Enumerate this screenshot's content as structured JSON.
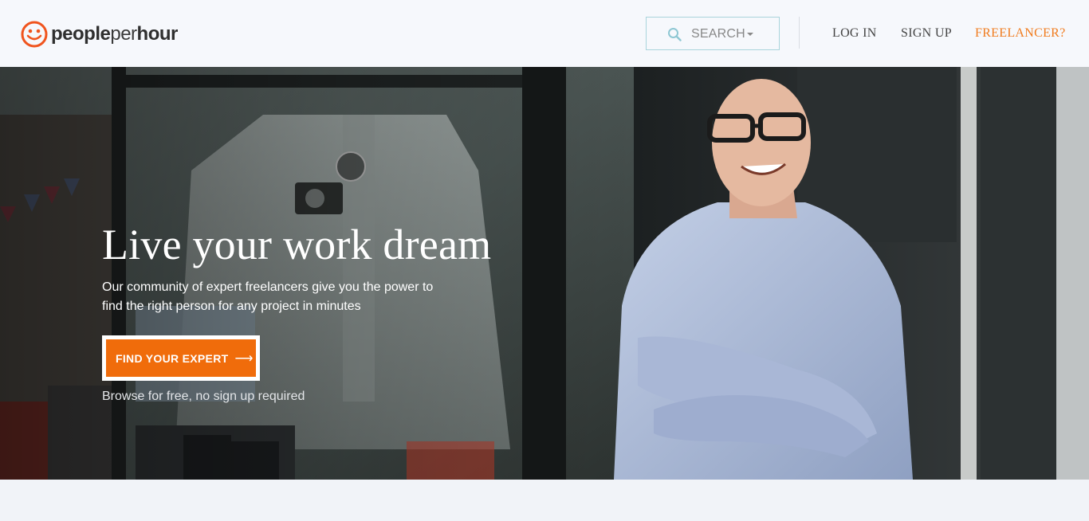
{
  "brand": {
    "name_part1": "people",
    "name_part2": "per",
    "name_part3": "hour",
    "accent_color": "#f06c0b",
    "logo_icon": "smiley-face-icon"
  },
  "header": {
    "search_label": "SEARCH",
    "search_icon": "search-icon",
    "nav": {
      "login": "LOG IN",
      "signup": "SIGN UP",
      "freelancer": "FREELANCER?"
    }
  },
  "hero": {
    "title": "Live your work dream",
    "subtitle": "Our community of expert freelancers give you the power to find the right person for any project in minutes",
    "cta_label": "FIND YOUR EXPERT",
    "cta_icon": "arrow-right-icon",
    "note": "Browse for free, no sign up required"
  }
}
